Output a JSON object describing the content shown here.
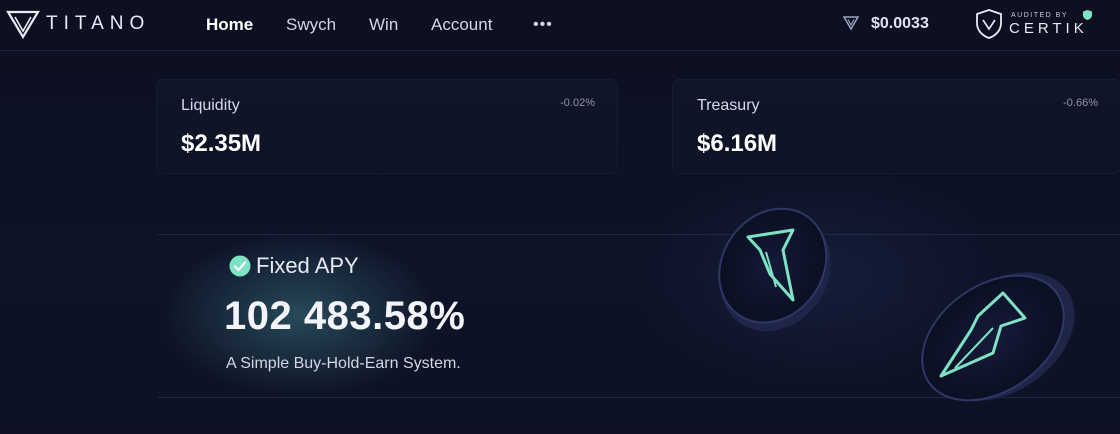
{
  "nav": {
    "brand": "TITANO",
    "items": [
      {
        "label": "Home",
        "active": true
      },
      {
        "label": "Swych",
        "active": false
      },
      {
        "label": "Win",
        "active": false
      },
      {
        "label": "Account",
        "active": false
      }
    ],
    "more": "•••",
    "price": "$0.0033",
    "audit": {
      "small": "AUDITED BY",
      "big": "CERTIK"
    }
  },
  "stats": [
    {
      "label": "Liquidity",
      "value": "$2.35M",
      "change": "-0.02%"
    },
    {
      "label": "Treasury",
      "value": "$6.16M",
      "change": "-0.66%"
    }
  ],
  "hero": {
    "label": "Fixed APY",
    "value": "102 483.58%",
    "tagline": "A Simple Buy-Hold-Earn System."
  },
  "colors": {
    "accent": "#7ee2c4",
    "background": "#0d1123",
    "card": "#101529"
  },
  "icons": {
    "logo": "titano-logo-icon",
    "price": "titano-token-icon",
    "audit": "certik-shield-icon",
    "check": "check-circle-icon"
  }
}
